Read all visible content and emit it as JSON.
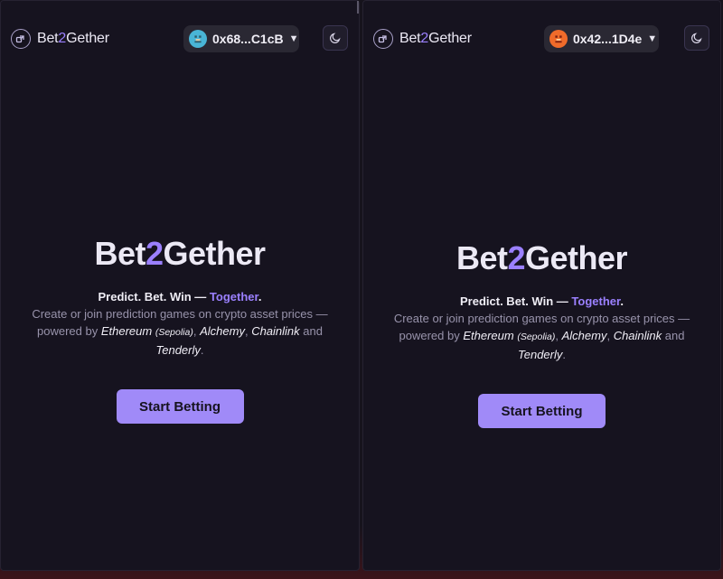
{
  "panels": [
    {
      "header": {
        "brand_pre": "Bet",
        "brand_num": "2",
        "brand_post": "Gether",
        "wallet_address": "0x68...C1cB",
        "avatar_icon": "pixel-avatar-blue",
        "theme_icon": "moon-icon"
      },
      "hero": {
        "title_pre": "Bet",
        "title_num": "2",
        "title_post": "Gether",
        "tagline_main": "Predict. Bet. Win — ",
        "tagline_accent": "Together",
        "tagline_end": ".",
        "desc_intro": "Create or join prediction games on crypto asset prices — powered by ",
        "desc_eth": "Ethereum",
        "desc_sepolia": "(Sepolia)",
        "desc_sep1": ", ",
        "desc_alchemy": "Alchemy",
        "desc_sep2": ", ",
        "desc_chainlink": "Chainlink",
        "desc_and": " and ",
        "desc_tenderly": "Tenderly",
        "desc_end": ".",
        "cta_label": "Start Betting"
      }
    },
    {
      "header": {
        "brand_pre": "Bet",
        "brand_num": "2",
        "brand_post": "Gether",
        "wallet_address": "0x42...1D4e",
        "avatar_icon": "pixel-avatar-orange",
        "theme_icon": "moon-icon"
      },
      "hero": {
        "title_pre": "Bet",
        "title_num": "2",
        "title_post": "Gether",
        "tagline_main": "Predict. Bet. Win — ",
        "tagline_accent": "Together",
        "tagline_end": ".",
        "desc_intro": "Create or join prediction games on crypto asset prices — powered by ",
        "desc_eth": "Ethereum",
        "desc_sepolia": "(Sepolia)",
        "desc_sep1": ", ",
        "desc_alchemy": "Alchemy",
        "desc_sep2": ", ",
        "desc_chainlink": "Chainlink",
        "desc_and": " and ",
        "desc_tenderly": "Tenderly",
        "desc_end": ".",
        "cta_label": "Start Betting"
      }
    }
  ],
  "colors": {
    "background": "#16131f",
    "accent": "#9b80ff",
    "button": "#a08af8",
    "text": "#ece9f5",
    "muted": "#9893ab"
  }
}
